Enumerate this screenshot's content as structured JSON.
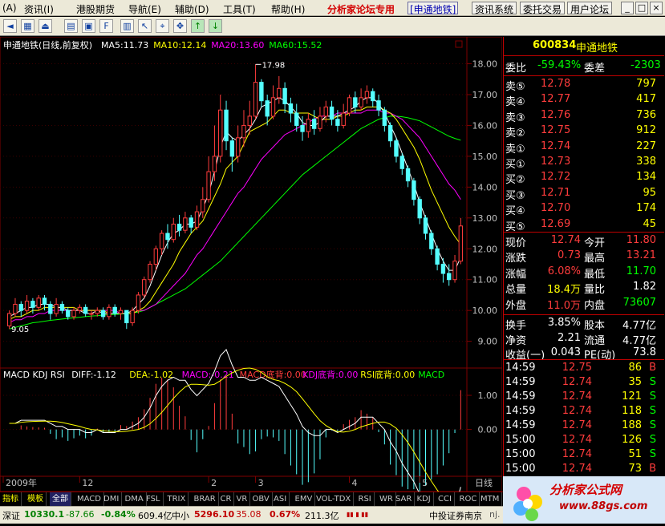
{
  "menu": {
    "items": [
      "(A)",
      "资讯(I)",
      "港股期货",
      "导航(E)",
      "辅助(D)",
      "工具(T)",
      "帮助(H)"
    ],
    "forum_tag": "分析家论坛专用",
    "stock_tag": "[申通地铁]",
    "right_buttons": [
      "资讯系统",
      "委托交易",
      "用户论坛"
    ],
    "window_buttons": [
      "_",
      "□",
      "×"
    ]
  },
  "toolbar": {
    "icons": [
      "left-arrow-icon",
      "chart-icon",
      "exit-icon",
      "grid-icon",
      "monitor-icon",
      "f-icon",
      "stats-icon",
      "cursor-icon",
      "select-icon",
      "move-icon",
      "up-arrow-icon",
      "down-arrow-icon"
    ]
  },
  "colors": {
    "up": "#ff3c3c",
    "down": "#54ffff",
    "ma5": "#ffffff",
    "ma10": "#ffff00",
    "ma20": "#ff00ff",
    "ma60": "#00ff00",
    "grid": "#800000",
    "cyan_text": "#00ffff",
    "green_text": "#00ff00",
    "yellow_text": "#ffff00"
  },
  "chart": {
    "title": "申通地铁(日线,前复权)",
    "ma_labels": [
      {
        "text": "MA5:11.73",
        "color": "#ffffff"
      },
      {
        "text": "MA10:12.14",
        "color": "#ffff00"
      },
      {
        "text": "MA20:13.60",
        "color": "#ff00ff"
      },
      {
        "text": "MA60:15.52",
        "color": "#00ff00"
      }
    ],
    "y_ticks": [
      "18.00",
      "17.00",
      "16.00",
      "15.00",
      "14.00",
      "13.00",
      "12.00",
      "11.00",
      "10.00",
      "9.00"
    ],
    "y_tick_values": [
      18,
      17,
      16,
      15,
      14,
      13,
      12,
      11,
      10,
      9
    ],
    "high_annotation": "17.98",
    "low_annotation": "9.05",
    "x_ticks": [
      "2009年",
      "12",
      "2",
      "3",
      "4",
      "5"
    ],
    "x_right_label": "日线",
    "indicator_labels": [
      {
        "text": "MACD KDJ RSI",
        "color": "#ffffff"
      },
      {
        "text": "DIFF:-1.12",
        "color": "#ffffff"
      },
      {
        "text": "DEA:-1.02",
        "color": "#ffff00"
      },
      {
        "text": "MACD:-0.21",
        "color": "#ff00ff"
      },
      {
        "text": "MACD底背:0.00",
        "color": "#ff3c3c"
      },
      {
        "text": "KDJ底背:0.00",
        "color": "#ff00ff"
      },
      {
        "text": "RSI底背:0.00",
        "color": "#ffff00"
      },
      {
        "text": "MACD",
        "color": "#00ff00"
      }
    ],
    "indicator_ticks": [
      "1.00",
      "0.00"
    ]
  },
  "chart_data": {
    "type": "candlestick",
    "title": "申通地铁(日线,前复权)",
    "ylim": [
      8.6,
      18.3
    ],
    "candles": [
      [
        9.5,
        9.9,
        9.4,
        10.0
      ],
      [
        9.9,
        10.2,
        9.8,
        10.4
      ],
      [
        10.2,
        10.0,
        9.8,
        10.3
      ],
      [
        10.0,
        10.3,
        9.9,
        10.5
      ],
      [
        10.3,
        10.1,
        9.9,
        10.4
      ],
      [
        10.1,
        10.4,
        10.0,
        10.5
      ],
      [
        10.4,
        10.2,
        10.0,
        10.5
      ],
      [
        10.2,
        9.9,
        9.7,
        10.3
      ],
      [
        9.9,
        10.2,
        9.8,
        10.4
      ],
      [
        10.2,
        10.0,
        9.9,
        10.3
      ],
      [
        10.0,
        9.8,
        9.7,
        10.1
      ],
      [
        9.8,
        10.0,
        9.7,
        10.1
      ],
      [
        10.0,
        10.1,
        9.9,
        10.2
      ],
      [
        10.1,
        9.9,
        9.8,
        10.2
      ],
      [
        9.9,
        9.9,
        9.7,
        10.0
      ],
      [
        9.9,
        10.0,
        9.8,
        10.1
      ],
      [
        10.0,
        9.8,
        9.7,
        10.1
      ],
      [
        9.8,
        10.1,
        9.7,
        10.2
      ],
      [
        10.1,
        9.9,
        9.8,
        10.2
      ],
      [
        9.9,
        10.0,
        9.7,
        10.1
      ],
      [
        10.0,
        9.6,
        9.4,
        10.0
      ],
      [
        9.6,
        10.0,
        9.5,
        10.1
      ],
      [
        10.0,
        10.5,
        9.9,
        10.6
      ],
      [
        10.5,
        11.0,
        10.4,
        11.1
      ],
      [
        11.0,
        11.5,
        10.9,
        11.6
      ],
      [
        11.5,
        12.0,
        11.3,
        12.1
      ],
      [
        12.0,
        12.5,
        11.8,
        12.6
      ],
      [
        12.5,
        12.3,
        12.0,
        12.8
      ],
      [
        12.3,
        12.8,
        12.2,
        13.0
      ],
      [
        12.8,
        12.6,
        12.4,
        13.1
      ],
      [
        12.6,
        13.0,
        12.5,
        13.2
      ],
      [
        13.0,
        12.7,
        12.5,
        13.1
      ],
      [
        12.7,
        13.2,
        12.6,
        13.4
      ],
      [
        13.2,
        13.6,
        13.0,
        14.0
      ],
      [
        13.6,
        14.5,
        13.5,
        15.0
      ],
      [
        14.5,
        15.0,
        14.2,
        16.0
      ],
      [
        15.0,
        16.5,
        14.8,
        17.0
      ],
      [
        16.5,
        15.5,
        15.2,
        16.8
      ],
      [
        15.5,
        15.0,
        14.5,
        15.6
      ],
      [
        15.0,
        15.6,
        14.8,
        16.0
      ],
      [
        15.6,
        16.0,
        15.3,
        16.5
      ],
      [
        16.0,
        16.3,
        15.7,
        16.8
      ],
      [
        16.3,
        17.4,
        16.2,
        17.98
      ],
      [
        17.4,
        16.8,
        16.6,
        17.5
      ],
      [
        16.8,
        16.3,
        16.0,
        17.0
      ],
      [
        16.3,
        16.9,
        16.2,
        17.3
      ],
      [
        16.9,
        17.2,
        16.7,
        17.6
      ],
      [
        17.2,
        16.7,
        16.4,
        17.4
      ],
      [
        16.7,
        16.4,
        16.1,
        16.9
      ],
      [
        16.4,
        16.0,
        15.8,
        16.7
      ],
      [
        16.0,
        15.8,
        15.5,
        16.3
      ],
      [
        15.8,
        16.2,
        15.6,
        16.4
      ],
      [
        16.2,
        15.9,
        15.7,
        16.5
      ],
      [
        15.9,
        16.3,
        15.8,
        16.6
      ],
      [
        16.3,
        16.6,
        16.1,
        16.8
      ],
      [
        16.6,
        16.2,
        16.0,
        16.8
      ],
      [
        16.2,
        16.0,
        15.8,
        16.5
      ],
      [
        16.0,
        16.4,
        15.9,
        16.7
      ],
      [
        16.4,
        16.9,
        16.3,
        17.0
      ],
      [
        16.9,
        16.6,
        16.4,
        17.1
      ],
      [
        16.6,
        16.9,
        16.5,
        17.2
      ],
      [
        16.9,
        17.1,
        16.7,
        17.3
      ],
      [
        17.1,
        16.8,
        16.6,
        17.2
      ],
      [
        16.8,
        16.5,
        16.3,
        17.0
      ],
      [
        16.5,
        16.0,
        15.8,
        16.6
      ],
      [
        16.0,
        15.5,
        15.3,
        16.1
      ],
      [
        15.5,
        15.0,
        14.8,
        15.6
      ],
      [
        15.0,
        14.6,
        14.4,
        15.1
      ],
      [
        14.6,
        14.2,
        14.0,
        14.7
      ],
      [
        14.2,
        13.6,
        13.4,
        14.3
      ],
      [
        13.6,
        13.0,
        12.8,
        13.7
      ],
      [
        13.0,
        12.5,
        12.3,
        13.1
      ],
      [
        12.5,
        12.0,
        11.8,
        12.6
      ],
      [
        12.0,
        11.5,
        11.3,
        12.1
      ],
      [
        11.5,
        11.2,
        10.9,
        11.7
      ],
      [
        11.2,
        11.0,
        10.8,
        11.5
      ],
      [
        11.0,
        11.6,
        10.9,
        11.8
      ],
      [
        11.6,
        12.74,
        11.5,
        13.0
      ]
    ],
    "ma5": [
      9.8,
      9.9,
      10.0,
      10.1,
      10.1,
      10.2,
      10.2,
      10.2,
      10.1,
      10.1,
      10.0,
      10.0,
      10.0,
      9.9,
      9.9,
      10.0,
      9.9,
      9.9,
      9.9,
      9.9,
      9.9,
      10.0,
      10.2,
      10.4,
      10.8,
      11.3,
      11.8,
      12.2,
      12.5,
      12.6,
      12.8,
      12.8,
      12.9,
      13.3,
      13.8,
      14.5,
      15.3,
      15.8,
      15.6,
      15.5,
      15.7,
      15.9,
      16.2,
      16.6,
      16.7,
      16.8,
      16.9,
      16.8,
      16.6,
      16.4,
      16.1,
      16.0,
      16.0,
      16.1,
      16.3,
      16.3,
      16.3,
      16.4,
      16.5,
      16.6,
      16.8,
      16.9,
      16.9,
      16.7,
      16.4,
      16.0,
      15.6,
      15.1,
      14.6,
      14.1,
      13.5,
      13.0,
      12.5,
      12.0,
      11.6,
      11.3,
      11.3,
      11.73
    ],
    "ma10": [
      9.7,
      9.8,
      9.8,
      9.9,
      10.0,
      10.0,
      10.1,
      10.1,
      10.1,
      10.1,
      10.1,
      10.1,
      10.0,
      10.0,
      10.0,
      10.0,
      10.0,
      9.9,
      9.9,
      9.9,
      9.9,
      9.9,
      10.0,
      10.1,
      10.3,
      10.6,
      10.9,
      11.2,
      11.5,
      11.9,
      12.2,
      12.5,
      12.7,
      12.9,
      13.3,
      13.7,
      14.1,
      14.6,
      14.8,
      15.0,
      15.4,
      15.8,
      15.9,
      16.0,
      16.1,
      16.3,
      16.5,
      16.5,
      16.4,
      16.4,
      16.4,
      16.4,
      16.3,
      16.2,
      16.2,
      16.2,
      16.3,
      16.3,
      16.4,
      16.5,
      16.5,
      16.6,
      16.6,
      16.6,
      16.5,
      16.4,
      16.2,
      15.9,
      15.6,
      15.3,
      14.9,
      14.4,
      13.9,
      13.5,
      13.1,
      12.7,
      12.4,
      12.14
    ],
    "ma20": [
      9.6,
      9.7,
      9.7,
      9.8,
      9.8,
      9.9,
      9.9,
      10.0,
      10.0,
      10.0,
      10.0,
      10.0,
      10.0,
      10.0,
      10.0,
      10.0,
      10.0,
      10.0,
      10.0,
      9.9,
      9.9,
      9.9,
      10.0,
      10.0,
      10.1,
      10.2,
      10.4,
      10.6,
      10.8,
      11.0,
      11.2,
      11.5,
      11.8,
      12.0,
      12.3,
      12.6,
      12.9,
      13.2,
      13.5,
      13.8,
      14.0,
      14.3,
      14.6,
      14.9,
      15.1,
      15.3,
      15.5,
      15.7,
      15.8,
      15.9,
      16.0,
      16.1,
      16.2,
      16.3,
      16.3,
      16.3,
      16.4,
      16.4,
      16.4,
      16.4,
      16.4,
      16.5,
      16.5,
      16.5,
      16.4,
      16.4,
      16.3,
      16.2,
      16.0,
      15.8,
      15.6,
      15.3,
      15.0,
      14.7,
      14.4,
      14.1,
      13.9,
      13.6
    ],
    "ma60": [
      9.4,
      9.45,
      9.5,
      9.55,
      9.6,
      9.62,
      9.65,
      9.68,
      9.7,
      9.72,
      9.74,
      9.76,
      9.78,
      9.8,
      9.82,
      9.83,
      9.85,
      9.86,
      9.87,
      9.88,
      9.9,
      9.92,
      9.95,
      10.0,
      10.1,
      10.2,
      10.3,
      10.4,
      10.5,
      10.6,
      10.7,
      10.85,
      11.0,
      11.15,
      11.3,
      11.45,
      11.6,
      11.8,
      12.0,
      12.2,
      12.4,
      12.6,
      12.8,
      13.0,
      13.2,
      13.4,
      13.6,
      13.8,
      14.0,
      14.2,
      14.4,
      14.55,
      14.7,
      14.85,
      15.0,
      15.15,
      15.3,
      15.45,
      15.6,
      15.75,
      15.9,
      16.0,
      16.1,
      16.2,
      16.25,
      16.3,
      16.3,
      16.28,
      16.25,
      16.2,
      16.15,
      16.05,
      15.95,
      15.85,
      15.75,
      15.65,
      15.58,
      15.52
    ],
    "macd": {
      "diff_last": -1.12,
      "dea_last": -1.02,
      "macd_last": -0.21,
      "ylim": [
        -1.3,
        1.4
      ]
    }
  },
  "right_panel": {
    "stock_code": "600834",
    "stock_name": "申通地铁",
    "weibi_label": "委比",
    "weibi_value": "-59.43%",
    "weicha_label": "委差",
    "weicha_value": "-2303",
    "sells": [
      {
        "label": "卖⑤",
        "price": "12.78",
        "vol": "797"
      },
      {
        "label": "卖④",
        "price": "12.77",
        "vol": "417"
      },
      {
        "label": "卖③",
        "price": "12.76",
        "vol": "736"
      },
      {
        "label": "卖②",
        "price": "12.75",
        "vol": "912"
      },
      {
        "label": "卖①",
        "price": "12.74",
        "vol": "227"
      }
    ],
    "buys": [
      {
        "label": "买①",
        "price": "12.73",
        "vol": "338"
      },
      {
        "label": "买②",
        "price": "12.72",
        "vol": "134"
      },
      {
        "label": "买③",
        "price": "12.71",
        "vol": "95"
      },
      {
        "label": "买④",
        "price": "12.70",
        "vol": "174"
      },
      {
        "label": "买⑤",
        "price": "12.69",
        "vol": "45"
      }
    ],
    "quote": [
      {
        "l1": "现价",
        "v1": "12.74",
        "c1": "#ff3c3c",
        "l2": "今开",
        "v2": "11.80",
        "c2": "#ff3c3c"
      },
      {
        "l1": "涨跌",
        "v1": "0.73",
        "c1": "#ff3c3c",
        "l2": "最高",
        "v2": "13.21",
        "c2": "#ff3c3c"
      },
      {
        "l1": "涨幅",
        "v1": "6.08%",
        "c1": "#ff3c3c",
        "l2": "最低",
        "v2": "11.70",
        "c2": "#00ff00"
      },
      {
        "l1": "总量",
        "v1": "18.4万",
        "c1": "#ffff00",
        "l2": "量比",
        "v2": "1.82",
        "c2": "#ffffff"
      },
      {
        "l1": "外盘",
        "v1": "11.0万",
        "c1": "#ff3c3c",
        "l2": "内盘",
        "v2": "73607",
        "c2": "#00ff00"
      }
    ],
    "fund": [
      {
        "l1": "换手",
        "v1": "3.85%",
        "l2": "股本",
        "v2": "4.77亿"
      },
      {
        "l1": "净资",
        "v1": "2.21",
        "l2": "流通",
        "v2": "4.77亿"
      },
      {
        "l1": "收益(一)",
        "v1": "0.043",
        "l2": "PE(动)",
        "v2": "73.8"
      }
    ],
    "ticks": [
      {
        "time": "14:59",
        "price": "12.75",
        "vol": "86",
        "bs": "B"
      },
      {
        "time": "14:59",
        "price": "12.74",
        "vol": "35",
        "bs": "S"
      },
      {
        "time": "14:59",
        "price": "12.74",
        "vol": "121",
        "bs": "S"
      },
      {
        "time": "14:59",
        "price": "12.74",
        "vol": "118",
        "bs": "S"
      },
      {
        "time": "14:59",
        "price": "12.74",
        "vol": "188",
        "bs": "S"
      },
      {
        "time": "15:00",
        "price": "12.74",
        "vol": "126",
        "bs": "S"
      },
      {
        "time": "15:00",
        "price": "12.74",
        "vol": "51",
        "bs": "S"
      },
      {
        "time": "15:00",
        "price": "12.74",
        "vol": "73",
        "bs": "B"
      }
    ]
  },
  "bottom_tabs": [
    "指标",
    "模板",
    "全部",
    "MACD",
    "DMI",
    "DMA",
    "FSL",
    "TRIX",
    "BRAR",
    "CR",
    "VR",
    "OBV",
    "ASI",
    "EMV",
    "VOL-TDX",
    "RSI",
    "WR",
    "SAR",
    "KDJ",
    "CCI",
    "ROC",
    "MTM"
  ],
  "status": {
    "sh_label": "深证",
    "sh_value": "10330.1",
    "sh_change": "-87.66",
    "sh_pct": "-0.84%",
    "sh_amount": "609.4亿",
    "zx_label": "中小",
    "zx_value": "5296.10",
    "zx_change": "35.08",
    "zx_pct": "0.67%",
    "zx_amount": "211.3亿",
    "broker": "中投证券南京",
    "broker_suffix": "nj.",
    "logo_text": "分析家公式网",
    "logo_url": "www.88gs.com"
  }
}
